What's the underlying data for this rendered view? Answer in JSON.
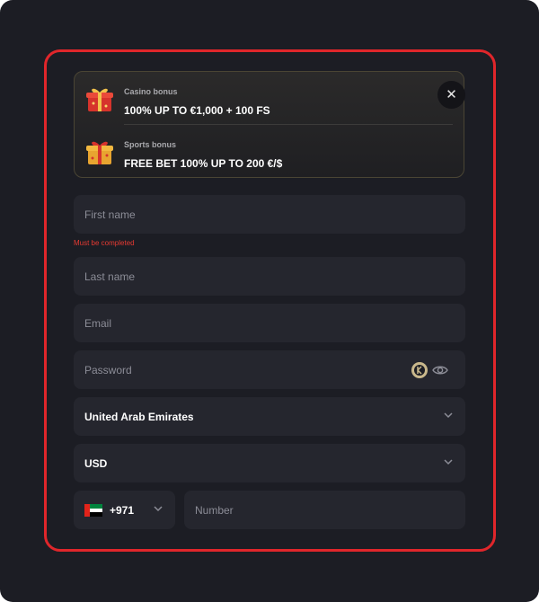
{
  "bonuses": [
    {
      "label": "Casino bonus",
      "value": "100% UP TO €1,000 + 100 FS",
      "icon": "gift-box-red-icon"
    },
    {
      "label": "Sports bonus",
      "value": "FREE BET 100% UP TO 200 €/$",
      "icon": "gift-box-gold-icon"
    }
  ],
  "close_label": "✕",
  "form": {
    "first_name_placeholder": "First name",
    "first_name_error": "Must be completed",
    "last_name_placeholder": "Last name",
    "email_placeholder": "Email",
    "password_placeholder": "Password",
    "country_value": "United Arab Emirates",
    "currency_value": "USD",
    "phone_code": "+971",
    "phone_placeholder": "Number"
  },
  "colors": {
    "background": "#1c1d24",
    "field": "#25262e",
    "highlight": "#e0262b",
    "error": "#e73a32"
  }
}
